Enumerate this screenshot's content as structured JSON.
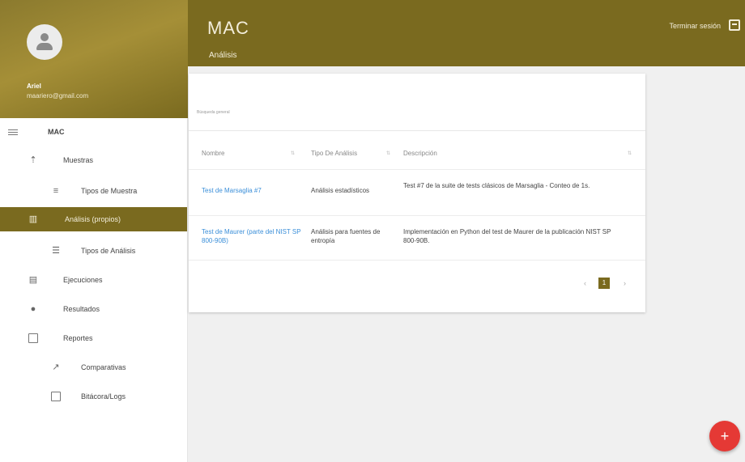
{
  "header": {
    "title": "MAC",
    "subtitle": "Análisis",
    "logout_label": "Terminar sesión"
  },
  "user": {
    "name": "Ariel",
    "email": "maariero@gmail.com"
  },
  "nav": {
    "mac": "MAC",
    "muestras": "Muestras",
    "tipos_muestra": "Tipos de Muestra",
    "analisis_propios": "Análisis (propios)",
    "tipos_analisis": "Tipos de Análisis",
    "ejecuciones": "Ejecuciones",
    "resultados": "Resultados",
    "reportes": "Reportes",
    "comparativas": "Comparativas",
    "bitacora": "Bitácora/Logs"
  },
  "table": {
    "search_placeholder": "Búsqueda general",
    "columns": [
      "Nombre",
      "Tipo De Análisis",
      "Descripción"
    ],
    "rows": [
      {
        "nombre": "Test de Marsaglia #7",
        "tipo": "Análisis estadísticos",
        "descripcion": "Test #7 de la suite de tests clásicos de Marsaglia - Conteo de 1s."
      },
      {
        "nombre": "Test de Maurer (parte del NIST SP 800-90B)",
        "tipo": "Análisis para fuentes de entropía",
        "descripcion": "Implementación en Python del test de Maurer de la publicación NIST SP 800-90B."
      }
    ],
    "page": "1"
  },
  "fab_label": "+",
  "colors": {
    "primary": "#7a6a1f",
    "link": "#3b8fd9",
    "fab": "#e53935"
  }
}
